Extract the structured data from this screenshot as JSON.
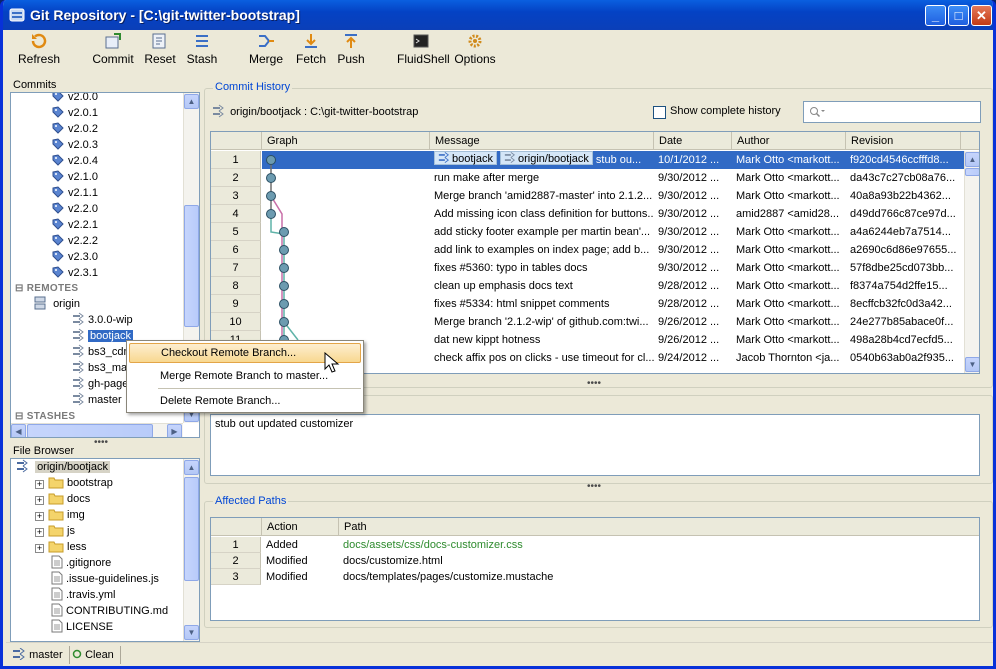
{
  "window": {
    "title": "Git Repository - [C:\\git-twitter-bootstrap]",
    "controls": [
      "_",
      "□",
      "✕"
    ]
  },
  "toolbar": {
    "items": [
      {
        "label": "Refresh",
        "icon": "refresh-icon"
      },
      {
        "label": "Commit",
        "icon": "commit-icon"
      },
      {
        "label": "Reset",
        "icon": "reset-icon"
      },
      {
        "label": "Stash",
        "icon": "stash-icon"
      },
      {
        "label": "Merge",
        "icon": "merge-icon"
      },
      {
        "label": "Fetch",
        "icon": "fetch-icon"
      },
      {
        "label": "Push",
        "icon": "push-icon"
      },
      {
        "label": "FluidShell",
        "icon": "fluidshell-icon"
      },
      {
        "label": "Options",
        "icon": "options-icon"
      }
    ]
  },
  "commits_panel": {
    "label": "Commits",
    "tags": [
      "v2.0.0",
      "v2.0.1",
      "v2.0.2",
      "v2.0.3",
      "v2.0.4",
      "v2.1.0",
      "v2.1.1",
      "v2.2.0",
      "v2.2.1",
      "v2.2.2",
      "v2.3.0",
      "v2.3.1"
    ],
    "remotes_label": "REMOTES",
    "remote_name": "origin",
    "branches": [
      "3.0.0-wip",
      "bootjack",
      "bs3_cdn",
      "bs3_ma",
      "gh-page",
      "master"
    ],
    "stashes_label": "STASHES"
  },
  "file_browser": {
    "label": "File Browser",
    "root": "origin/bootjack",
    "folders": [
      "bootstrap",
      "docs",
      "img",
      "js",
      "less"
    ],
    "files": [
      ".gitignore",
      ".issue-guidelines.js",
      ".travis.yml",
      "CONTRIBUTING.md",
      "LICENSE"
    ]
  },
  "context_menu": {
    "items": [
      "Checkout Remote Branch...",
      "Merge Remote Branch to master...",
      "Delete Remote Branch..."
    ]
  },
  "commit_history": {
    "legend": "Commit History",
    "branch_path": "origin/bootjack : C:\\git-twitter-bootstrap",
    "show_complete_history": "Show complete history",
    "search_placeholder": "",
    "columns": [
      "Graph",
      "Message",
      "Date",
      "Author",
      "Revision"
    ],
    "rows": [
      {
        "n": "1",
        "refs": [
          "bootjack",
          "origin/bootjack"
        ],
        "message": "stub ou...",
        "date": "10/1/2012 ...",
        "author": "Mark Otto <markott...",
        "revision": "f920cd4546ccfffd8..."
      },
      {
        "n": "2",
        "refs": [],
        "message": "run make after merge",
        "date": "9/30/2012 ...",
        "author": "Mark Otto <markott...",
        "revision": "da43c7c27cb08a76..."
      },
      {
        "n": "3",
        "refs": [],
        "message": "Merge branch 'amid2887-master' into 2.1.2...",
        "date": "9/30/2012 ...",
        "author": "Mark Otto <markott...",
        "revision": "40a8a93b22b4362..."
      },
      {
        "n": "4",
        "refs": [],
        "message": "Add missing icon class definition for buttons...",
        "date": "9/30/2012 ...",
        "author": "amid2887 <amid28...",
        "revision": "d49dd766c87ce97d..."
      },
      {
        "n": "5",
        "refs": [],
        "message": "add sticky footer example per martin bean'...",
        "date": "9/30/2012 ...",
        "author": "Mark Otto <markott...",
        "revision": "a4a6244eb7a7514..."
      },
      {
        "n": "6",
        "refs": [],
        "message": "add link to examples on index page; add b...",
        "date": "9/30/2012 ...",
        "author": "Mark Otto <markott...",
        "revision": "a2690c6d86e97655..."
      },
      {
        "n": "7",
        "refs": [],
        "message": "fixes #5360: typo in tables docs",
        "date": "9/30/2012 ...",
        "author": "Mark Otto <markott...",
        "revision": "57f8dbe25cd073bb..."
      },
      {
        "n": "8",
        "refs": [],
        "message": "clean up emphasis docs text",
        "date": "9/28/2012 ...",
        "author": "Mark Otto <markott...",
        "revision": "f8374a754d2ffe15..."
      },
      {
        "n": "9",
        "refs": [],
        "message": "fixes #5334: html snippet comments",
        "date": "9/28/2012 ...",
        "author": "Mark Otto <markott...",
        "revision": "8ecffcb32fc0d3a42..."
      },
      {
        "n": "10",
        "refs": [],
        "message": "Merge branch '2.1.2-wip' of github.com:twi...",
        "date": "9/26/2012 ...",
        "author": "Mark Otto <markott...",
        "revision": "24e277b85abace0f..."
      },
      {
        "n": "11",
        "refs": [],
        "message": "dat new kippt hotness",
        "date": "9/26/2012 ...",
        "author": "Mark Otto <markott...",
        "revision": "498a28b4cd7ecfd5..."
      },
      {
        "n": "12",
        "refs": [],
        "message": "check affix pos on clicks - use timeout for cl...",
        "date": "9/24/2012 ...",
        "author": "Jacob Thornton <ja...",
        "revision": "0540b63ab0a2f935..."
      }
    ]
  },
  "commit_message": "stub out updated customizer",
  "affected_paths": {
    "legend": "Affected Paths",
    "columns": [
      "Action",
      "Path"
    ],
    "rows": [
      {
        "n": "1",
        "action": "Added",
        "path": "docs/assets/css/docs-customizer.css"
      },
      {
        "n": "2",
        "action": "Modified",
        "path": "docs/customize.html"
      },
      {
        "n": "3",
        "action": "Modified",
        "path": "docs/templates/pages/customize.mustache"
      }
    ]
  },
  "statusbar": {
    "branch": "master",
    "state": "Clean"
  },
  "colors": {
    "selection": "#316ac5",
    "accent": "#0046d5",
    "added_path": "#2e8b2e",
    "graph_pink": "#c86fa8",
    "graph_teal": "#5fb3a8"
  }
}
